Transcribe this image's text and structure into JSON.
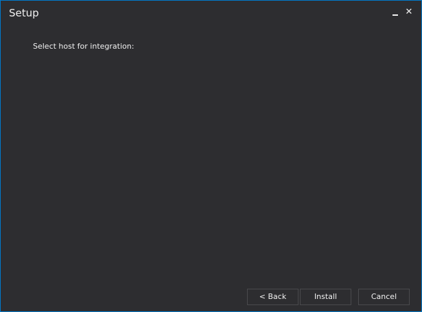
{
  "window": {
    "title": "Setup",
    "accent_color": "#007acc",
    "background_color": "#2d2d30",
    "minimize_icon": "minimize-icon",
    "close_icon": "close-icon",
    "close_glyph": "✕"
  },
  "main": {
    "prompt": "Select host for integration:"
  },
  "buttons": {
    "back": "< Back",
    "install": "Install",
    "cancel": "Cancel"
  }
}
